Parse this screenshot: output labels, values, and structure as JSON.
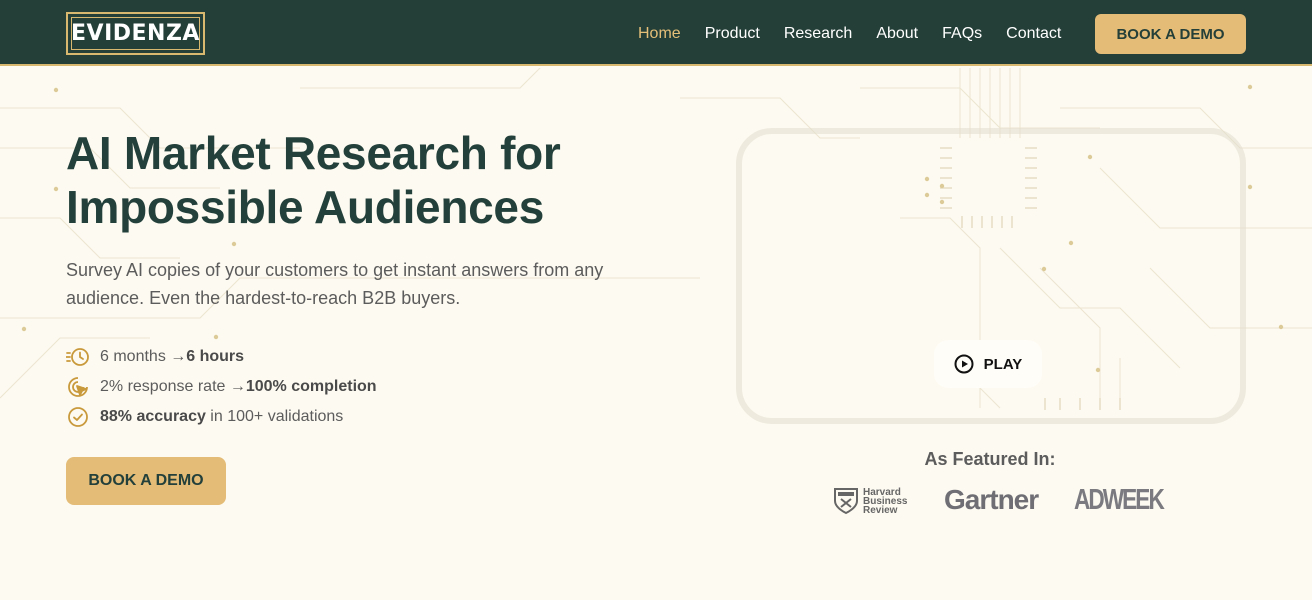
{
  "brand": {
    "name": "EVIDENZA"
  },
  "nav": {
    "links": [
      "Home",
      "Product",
      "Research",
      "About",
      "FAQs",
      "Contact"
    ],
    "active": "Home",
    "cta_label": "BOOK A DEMO"
  },
  "hero": {
    "title_line1": "AI Market Research for",
    "title_line2": "Impossible Audiences",
    "subtitle": "Survey AI copies of your customers to get instant answers from any audience. Even the hardest-to-reach B2B buyers.",
    "stats": [
      {
        "icon": "fast-clock-icon",
        "before": "6 months → ",
        "bold": "6 hours",
        "after": ""
      },
      {
        "icon": "target-cursor-icon",
        "before": "2% response rate → ",
        "bold": "100% completion",
        "after": ""
      },
      {
        "icon": "check-circle-icon",
        "before": "",
        "bold": "88% accuracy",
        "after": " in 100+ validations"
      }
    ],
    "cta_label": "BOOK A DEMO"
  },
  "video": {
    "play_label": "PLAY"
  },
  "featured": {
    "title": "As Featured In:",
    "logos": {
      "hbr": [
        "Harvard",
        "Business",
        "Review"
      ],
      "gartner": "Gartner",
      "adweek": "ADWEEK"
    }
  },
  "colors": {
    "nav_bg": "#243f38",
    "accent_gold": "#e4bc78",
    "heading": "#23403a",
    "page_bg": "#fdfaf1"
  }
}
